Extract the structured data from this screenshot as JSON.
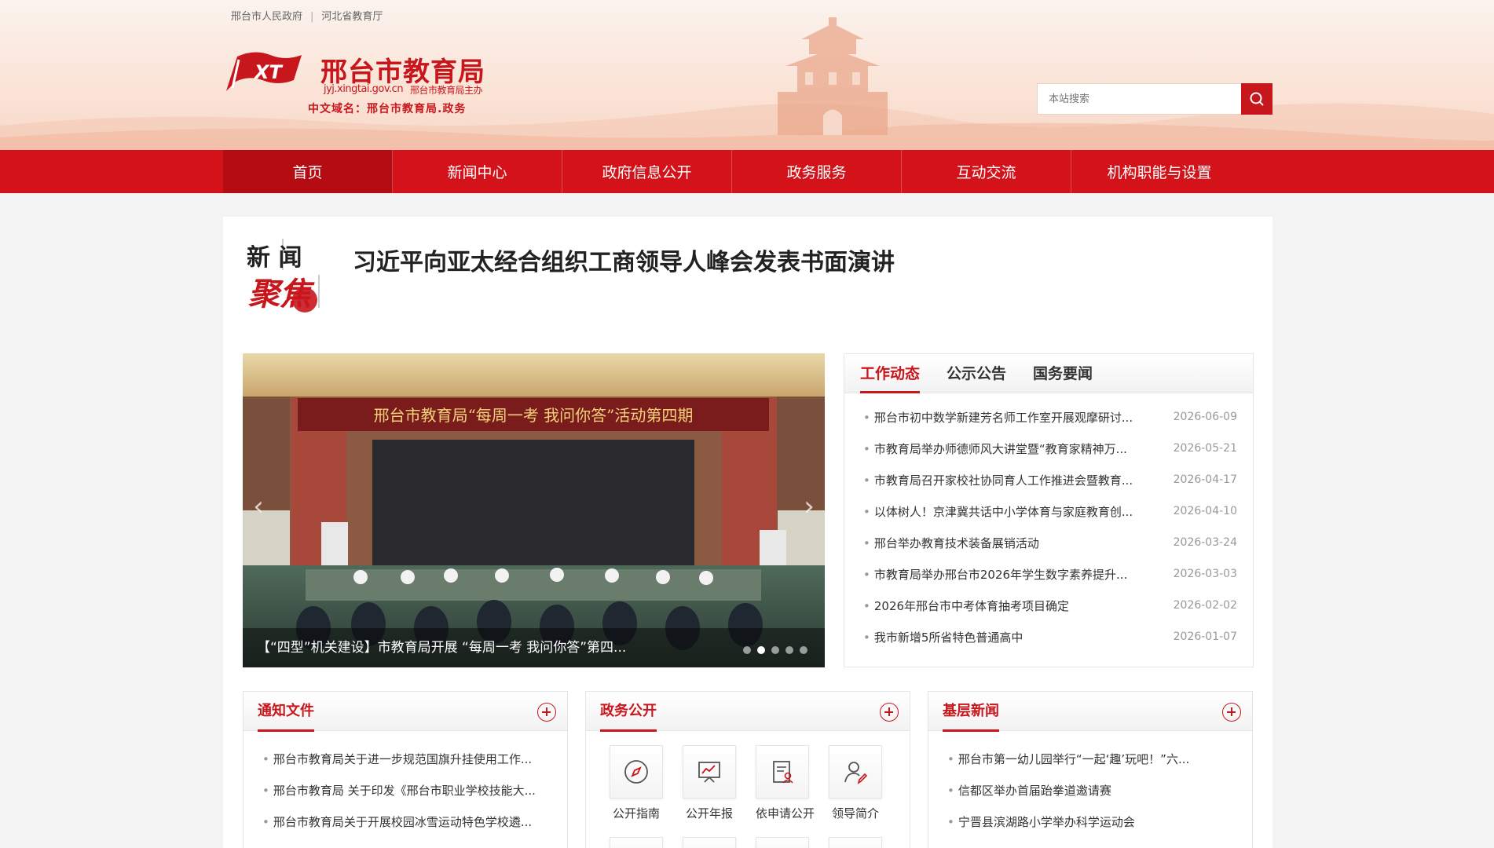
{
  "top_links": [
    "邢台市人民政府",
    "河北省教育厅"
  ],
  "top_links_separator": "|",
  "logo": {
    "mark_text": "XT",
    "title": "邢台市教育局",
    "domain": "jyj.xingtai.gov.cn",
    "sponsor": "邢台市教育局主办",
    "cn_domain": "中文域名：邢台市教育局.政务"
  },
  "search": {
    "placeholder": "本站搜索",
    "icon": "search-icon"
  },
  "nav": [
    "首页",
    "新闻中心",
    "政府信息公开",
    "政务服务",
    "互动交流",
    "机构职能与设置"
  ],
  "nav_active": "首页",
  "focus": {
    "badge_line1": "新 闻",
    "badge_line2": "聚焦",
    "headline": "习近平向亚太经合组织工商领导人峰会发表书面演讲"
  },
  "slider": {
    "banner_text": "邢台市教育局“每周一考 我问你答”活动第四期",
    "caption": "【“四型”机关建设】市教育局开展 “每周一考 我问你答”第四...",
    "prev_icon": "chevron-left-icon",
    "next_icon": "chevron-right-icon",
    "dot_count": 5,
    "active_dot": 2
  },
  "news_tabs": [
    "工作动态",
    "公示公告",
    "国务要闻"
  ],
  "news_tab_active": "工作动态",
  "news_items": [
    {
      "title": "邢台市初中数学新建芳名师工作室开展观摩研讨...",
      "date": "2026-06-09"
    },
    {
      "title": "市教育局举办师德师风大讲堂暨“教育家精神万...",
      "date": "2026-05-21"
    },
    {
      "title": "市教育局召开家校社协同育人工作推进会暨教育...",
      "date": "2026-04-17"
    },
    {
      "title": "以体树人！京津冀共话中小学体育与家庭教育创...",
      "date": "2026-04-10"
    },
    {
      "title": "邢台举办教育技术装备展销活动",
      "date": "2026-03-24"
    },
    {
      "title": "市教育局举办邢台市2026年学生数字素养提升...",
      "date": "2026-03-03"
    },
    {
      "title": "2026年邢台市中考体育抽考项目确定",
      "date": "2026-02-02"
    },
    {
      "title": "我市新增5所省特色普通高中",
      "date": "2026-01-07"
    }
  ],
  "panel_notice": {
    "title": "通知文件",
    "items": [
      "邢台市教育局关于进一步规范国旗升挂使用工作...",
      "邢台市教育局 关于印发《邢台市职业学校技能大...",
      "邢台市教育局关于开展校园冰雪运动特色学校遴..."
    ]
  },
  "panel_gov": {
    "title": "政务公开",
    "services": [
      {
        "label": "公开指南",
        "icon": "compass-icon"
      },
      {
        "label": "公开年报",
        "icon": "chart-board-icon"
      },
      {
        "label": "依申请公开",
        "icon": "document-user-icon"
      },
      {
        "label": "领导简介",
        "icon": "person-edit-icon"
      }
    ]
  },
  "panel_local": {
    "title": "基层新闻",
    "items": [
      "邢台市第一幼儿园举行“一起‘趣’玩吧！”六...",
      "信都区举办首届跆拳道邀请赛",
      "宁晋县滨湖路小学举办科学运动会"
    ]
  },
  "colors": {
    "brand_red": "#c8161d",
    "nav_red": "#d3121a",
    "nav_active": "#b50c13"
  }
}
